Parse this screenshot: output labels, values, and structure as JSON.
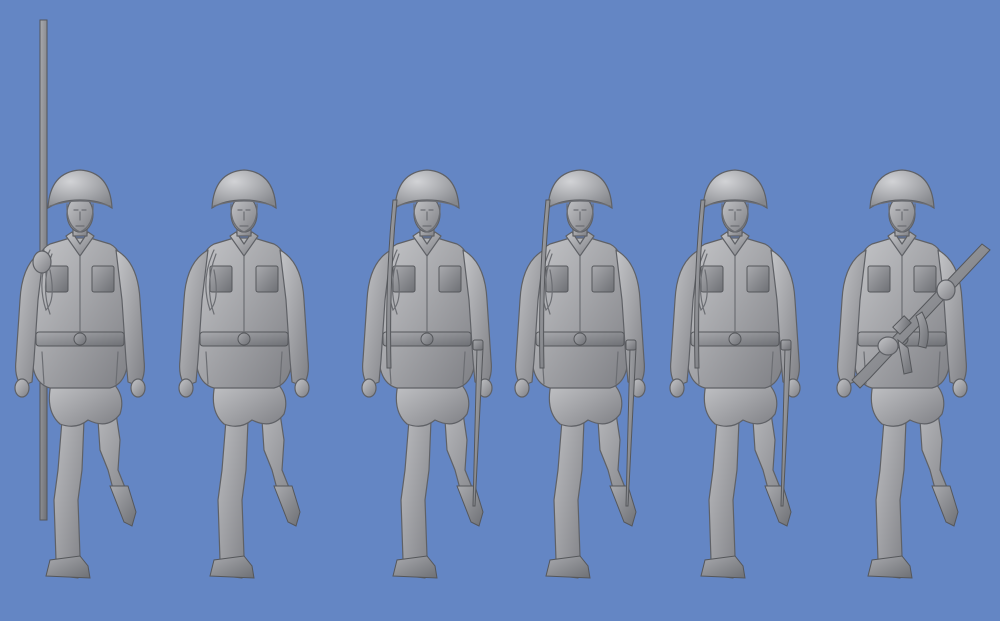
{
  "scene": {
    "background_color": "#6486c4",
    "figure_color": "#a7a8ab",
    "figures": [
      {
        "id": "flag-bearer",
        "equipment": "pole"
      },
      {
        "id": "officer",
        "equipment": "none"
      },
      {
        "id": "sword-bearer-1",
        "equipment": "sword"
      },
      {
        "id": "sword-bearer-2",
        "equipment": "sword"
      },
      {
        "id": "sword-bearer-3",
        "equipment": "sword"
      },
      {
        "id": "rifleman",
        "equipment": "rifle"
      }
    ]
  }
}
